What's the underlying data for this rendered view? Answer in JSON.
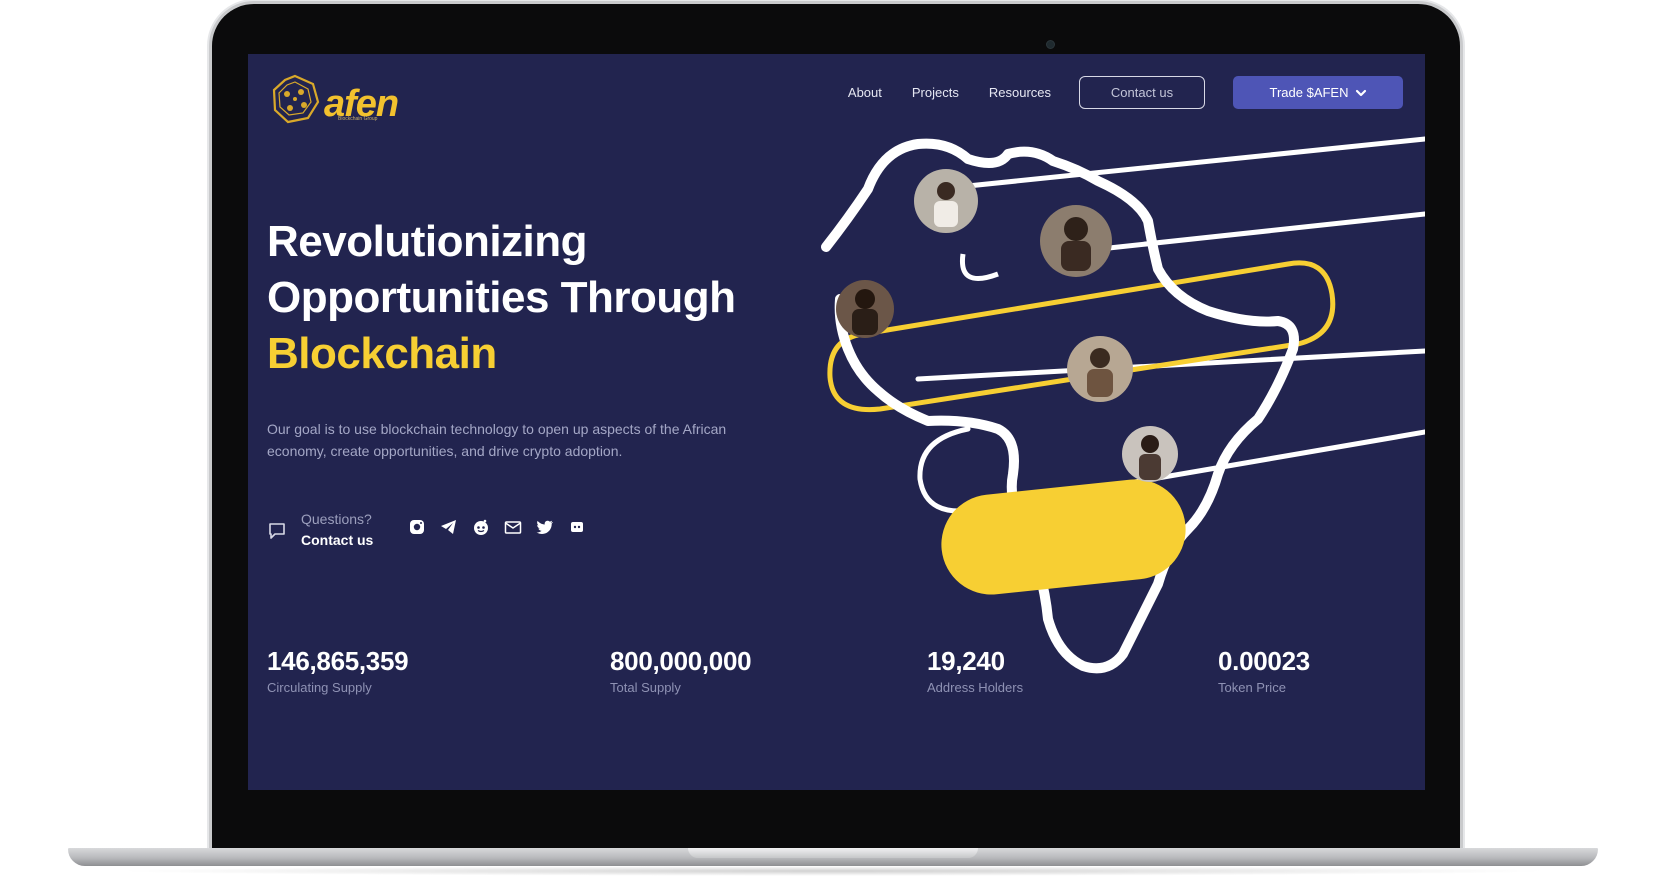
{
  "brand": {
    "name": "afen",
    "tagline": "Blockchain Group",
    "accent_color": "#f7cf33",
    "background_color": "#22244f",
    "button_color": "#4e55b6"
  },
  "nav": {
    "links": [
      "About",
      "Projects",
      "Resources"
    ],
    "contact_label": "Contact us",
    "trade_label": "Trade $AFEN",
    "trade_icon": "chevron-down-icon"
  },
  "hero": {
    "title_line1": "Revolutionizing",
    "title_line2": "Opportunities Through",
    "title_accent": "Blockchain",
    "description": "Our goal is to use blockchain technology to open up aspects of the African economy, create opportunities, and drive crypto adoption."
  },
  "contact": {
    "icon": "chat-bubble-icon",
    "label": "Questions?",
    "link": "Contact us"
  },
  "socials": [
    "instagram-icon",
    "telegram-icon",
    "reddit-icon",
    "medium-icon",
    "twitter-icon",
    "discord-icon"
  ],
  "stats": [
    {
      "value": "146,865,359",
      "label": "Circulating Supply"
    },
    {
      "value": "800,000,000",
      "label": "Total Supply"
    },
    {
      "value": "19,240",
      "label": "Address Holders"
    },
    {
      "value": "0.00023",
      "label": "Token Price"
    }
  ],
  "illustration": {
    "subject": "africa-map-outline",
    "avatars": 5
  }
}
